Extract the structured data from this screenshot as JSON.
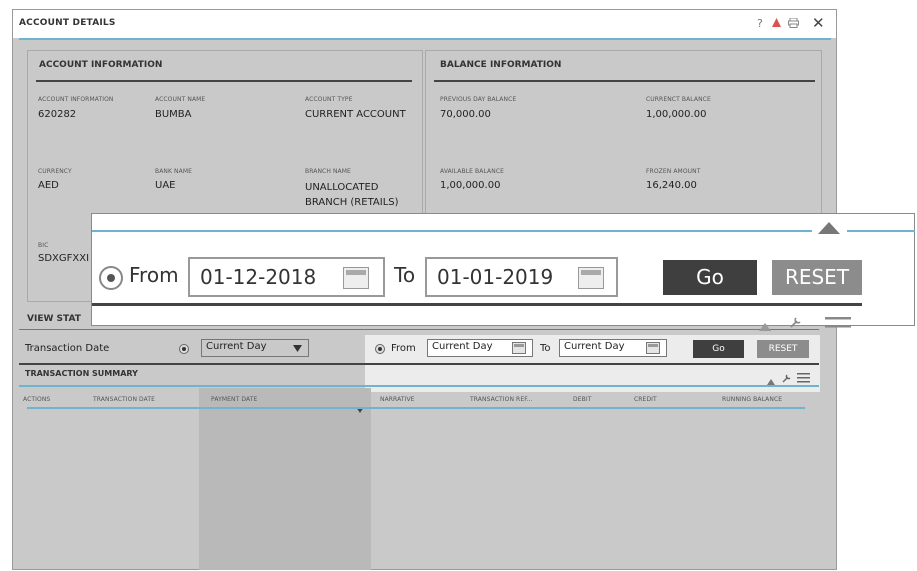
{
  "window": {
    "title": "ACCOUNT DETAILS",
    "icons": [
      "help-icon",
      "pdf-icon",
      "print-icon",
      "close-icon"
    ],
    "help_glyph": "?",
    "close_glyph": "✕"
  },
  "account_info": {
    "title": "ACCOUNT INFORMATION",
    "fields": [
      {
        "label": "ACCOUNT INFORMATION",
        "value": "620282"
      },
      {
        "label": "ACCOUNT NAME",
        "value": "BUMBA"
      },
      {
        "label": "ACCOUNT TYPE",
        "value": "CURRENT ACCOUNT"
      },
      {
        "label": "CURRENCY",
        "value": "AED"
      },
      {
        "label": "BANK NAME",
        "value": "UAE"
      },
      {
        "label": "BRANCH NAME",
        "value": "UNALLOCATED BRANCH (RETAILS)"
      },
      {
        "label": "BIC",
        "value": "SDXGFXXI"
      }
    ]
  },
  "balance_info": {
    "title": "BALANCE INFORMATION",
    "fields": [
      {
        "label": "PREVIOUS DAY BALANCE",
        "value": "70,000.00"
      },
      {
        "label": "CURRENCT BALANCE",
        "value": "1,00,000.00"
      },
      {
        "label": "AVAILABLE BALANCE",
        "value": "1,00,000.00"
      },
      {
        "label": "FROZEN AMOUNT",
        "value": "16,240.00"
      }
    ]
  },
  "statement": {
    "title": "VIEW STAT",
    "filter_label": "Transaction Date",
    "period_select": "Current Day",
    "from_label": "From",
    "from_value": "Current Day",
    "to_label": "To",
    "to_value": "Current Day",
    "go_label": "Go",
    "reset_label": "RESET"
  },
  "summary": {
    "title": "TRANSACTION SUMMARY",
    "columns": [
      "ACTIONS",
      "TRANSACTION DATE",
      "PAYMENT DATE",
      "NARRATIVE",
      "TRANSACTION REF...",
      "DEBIT",
      "CREDIT",
      "RUNNING BALANCE"
    ]
  },
  "zoom": {
    "from_label": "From",
    "from_value": "01-12-2018",
    "to_label": "To",
    "to_value": "01-01-2019",
    "go_label": "Go",
    "reset_label": "RESET"
  },
  "colors": {
    "accent": "#6fb4cf",
    "panel": "#c9c9c9",
    "dark_button": "#3f3f3f",
    "grey_button": "#8c8c8c"
  }
}
